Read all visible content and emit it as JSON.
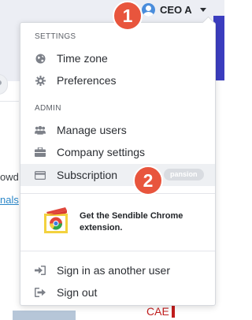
{
  "account": {
    "name": "CEO A"
  },
  "background": {
    "line1": "owd",
    "line2": "nals",
    "cae": "CAE"
  },
  "menu": {
    "settings_label": "SETTINGS",
    "settings_items": [
      {
        "label": "Time zone",
        "icon": "globe-icon"
      },
      {
        "label": "Preferences",
        "icon": "gear-icon"
      }
    ],
    "admin_label": "ADMIN",
    "admin_items": [
      {
        "label": "Manage users",
        "icon": "users-icon"
      },
      {
        "label": "Company settings",
        "icon": "briefcase-icon"
      },
      {
        "label": "Subscription",
        "icon": "credit-card-icon",
        "badge": "pansion"
      }
    ],
    "promo_text": "Get the Sendible Chrome extension.",
    "bottom_items": [
      {
        "label": "Sign in as another user",
        "icon": "sign-in-icon"
      },
      {
        "label": "Sign out",
        "icon": "sign-out-icon"
      }
    ]
  },
  "markers": {
    "step1": "1",
    "step2": "2"
  },
  "colors": {
    "marker": "#e8553d",
    "accent": "#3b3dbf",
    "link": "#2a86c7"
  }
}
